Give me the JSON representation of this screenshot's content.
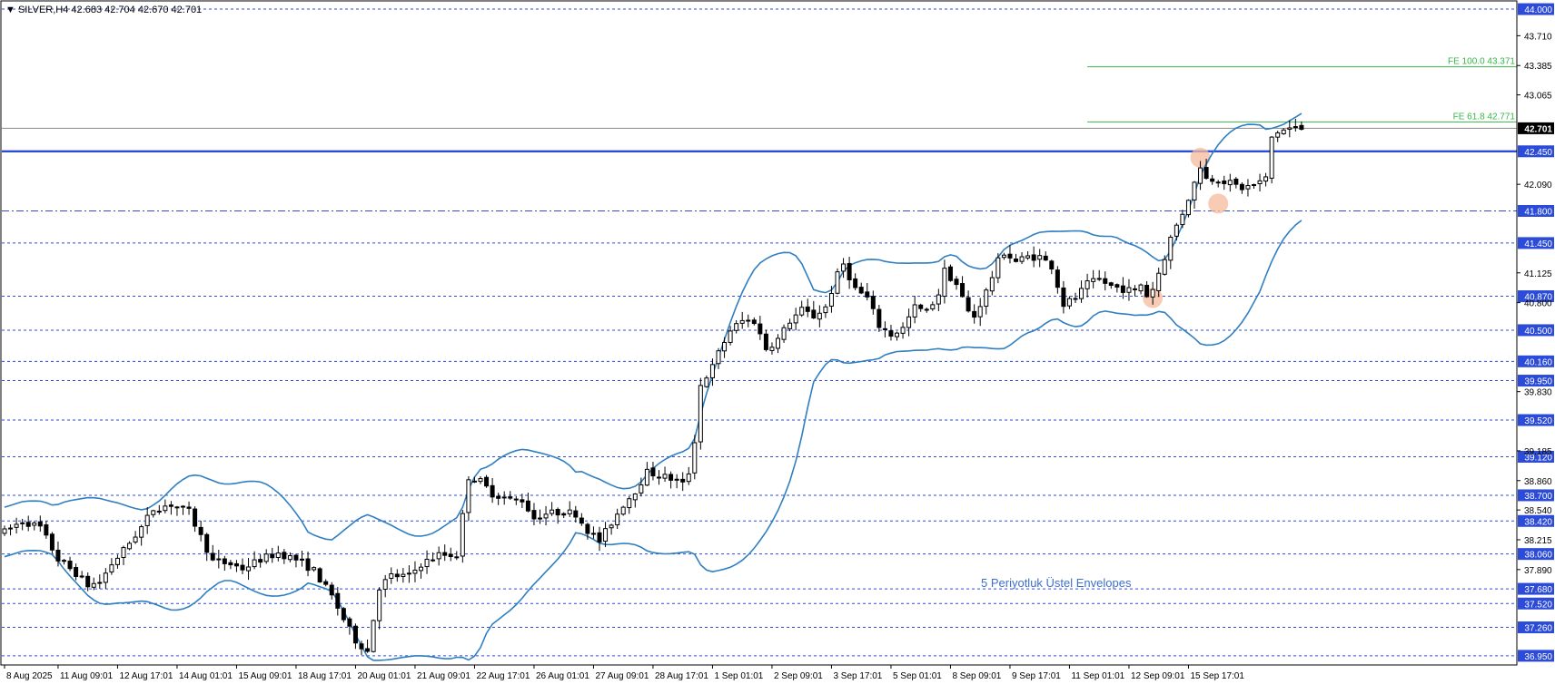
{
  "window": {
    "title_text": "▼ SILVER,H4  42.683 42.704 42.670 42.701"
  },
  "colors": {
    "background": "#ffffff",
    "frame": "#000000",
    "grid_dash": "#2b4bd8",
    "main_level": "#2b4bd8",
    "envelope": "#2f7fc1",
    "fib_line": "#39b54a",
    "fib_text": "#39b54a",
    "price_line": "#8a8a8a",
    "highlight": "#f6b99b",
    "tag_bg": "#2b4bd8",
    "tag_current_bg": "#000000",
    "annotation": "#3f70c8"
  },
  "annotation_text": "5 Periyotluk Üstel Envelopes",
  "chart_data": {
    "type": "candlestick",
    "symbol": "SILVER",
    "timeframe": "H4",
    "ylim": [
      36.85,
      44.05
    ],
    "y_ticks": [
      43.71,
      43.385,
      43.065,
      42.09,
      41.125,
      40.8,
      39.83,
      39.185,
      38.86,
      38.54,
      38.215,
      37.89
    ],
    "level_lines": [
      {
        "price": 44.0,
        "label": "44.000",
        "style": "dashed"
      },
      {
        "price": 42.45,
        "label": "42.450",
        "style": "solid"
      },
      {
        "price": 41.8,
        "label": "41.800",
        "style": "dashdot"
      },
      {
        "price": 41.45,
        "label": "41.450",
        "style": "dashed"
      },
      {
        "price": 40.87,
        "label": "40.870",
        "style": "dashed"
      },
      {
        "price": 40.5,
        "label": "40.500",
        "style": "dashed"
      },
      {
        "price": 40.16,
        "label": "40.160",
        "style": "dashed"
      },
      {
        "price": 39.95,
        "label": "39.950",
        "style": "dashed"
      },
      {
        "price": 39.52,
        "label": "39.520",
        "style": "dashed"
      },
      {
        "price": 39.12,
        "label": "39.120",
        "style": "dashed"
      },
      {
        "price": 38.7,
        "label": "38.700",
        "style": "dashed"
      },
      {
        "price": 38.42,
        "label": "38.420",
        "style": "dashed"
      },
      {
        "price": 38.06,
        "label": "38.060",
        "style": "dashed"
      },
      {
        "price": 37.68,
        "label": "37.680",
        "style": "dashed"
      },
      {
        "price": 37.52,
        "label": "37.520",
        "style": "dashed"
      },
      {
        "price": 37.26,
        "label": "37.260",
        "style": "dashed"
      },
      {
        "price": 36.95,
        "label": "36.950",
        "style": "dashed"
      }
    ],
    "current_price": {
      "price": 42.701,
      "label": "42.701"
    },
    "fibonacci": [
      {
        "label": "FE 100.0 43.371",
        "price": 43.371,
        "start_bar": 182
      },
      {
        "label": "FE 61.8 42.771",
        "price": 42.771,
        "start_bar": 182
      }
    ],
    "x_labels": [
      {
        "bar": 0,
        "label": "8 Aug 2025"
      },
      {
        "bar": 9,
        "label": "11 Aug 09:01"
      },
      {
        "bar": 19,
        "label": "12 Aug 17:01"
      },
      {
        "bar": 29,
        "label": "14 Aug 01:01"
      },
      {
        "bar": 39,
        "label": "15 Aug 09:01"
      },
      {
        "bar": 49,
        "label": "18 Aug 17:01"
      },
      {
        "bar": 59,
        "label": "20 Aug 01:01"
      },
      {
        "bar": 69,
        "label": "21 Aug 09:01"
      },
      {
        "bar": 79,
        "label": "22 Aug 17:01"
      },
      {
        "bar": 89,
        "label": "26 Aug 01:01"
      },
      {
        "bar": 99,
        "label": "27 Aug 09:01"
      },
      {
        "bar": 109,
        "label": "28 Aug 17:01"
      },
      {
        "bar": 119,
        "label": "1 Sep 01:01"
      },
      {
        "bar": 129,
        "label": "2 Sep 09:01"
      },
      {
        "bar": 139,
        "label": "3 Sep 17:01"
      },
      {
        "bar": 149,
        "label": "5 Sep 01:01"
      },
      {
        "bar": 159,
        "label": "8 Sep 09:01"
      },
      {
        "bar": 169,
        "label": "9 Sep 17:01"
      },
      {
        "bar": 179,
        "label": "11 Sep 01:01"
      },
      {
        "bar": 189,
        "label": "12 Sep 09:01"
      },
      {
        "bar": 199,
        "label": "15 Sep 17:01"
      }
    ],
    "anchors": [
      [
        0,
        38.3
      ],
      [
        3,
        38.42
      ],
      [
        6,
        38.35
      ],
      [
        9,
        38.0
      ],
      [
        12,
        37.85
      ],
      [
        14,
        37.72
      ],
      [
        16,
        37.75
      ],
      [
        18,
        37.95
      ],
      [
        20,
        38.1
      ],
      [
        23,
        38.35
      ],
      [
        25,
        38.55
      ],
      [
        28,
        38.6
      ],
      [
        31,
        38.52
      ],
      [
        33,
        38.25
      ],
      [
        35,
        37.98
      ],
      [
        38,
        37.95
      ],
      [
        40,
        37.9
      ],
      [
        43,
        38.0
      ],
      [
        46,
        38.07
      ],
      [
        49,
        38.0
      ],
      [
        52,
        37.88
      ],
      [
        55,
        37.6
      ],
      [
        57,
        37.35
      ],
      [
        59,
        37.12
      ],
      [
        61,
        37.0
      ],
      [
        63,
        37.7
      ],
      [
        65,
        37.82
      ],
      [
        68,
        37.82
      ],
      [
        70,
        37.95
      ],
      [
        73,
        38.05
      ],
      [
        76,
        38.05
      ],
      [
        78,
        38.9
      ],
      [
        80,
        38.85
      ],
      [
        82,
        38.72
      ],
      [
        85,
        38.65
      ],
      [
        87,
        38.65
      ],
      [
        89,
        38.45
      ],
      [
        91,
        38.5
      ],
      [
        94,
        38.52
      ],
      [
        96,
        38.5
      ],
      [
        98,
        38.32
      ],
      [
        100,
        38.2
      ],
      [
        102,
        38.4
      ],
      [
        104,
        38.6
      ],
      [
        106,
        38.75
      ],
      [
        108,
        38.95
      ],
      [
        110,
        38.92
      ],
      [
        112,
        38.88
      ],
      [
        114,
        38.82
      ],
      [
        115,
        38.95
      ],
      [
        116,
        39.3
      ],
      [
        117,
        39.9
      ],
      [
        119,
        40.1
      ],
      [
        120,
        40.25
      ],
      [
        122,
        40.5
      ],
      [
        124,
        40.6
      ],
      [
        126,
        40.6
      ],
      [
        128,
        40.3
      ],
      [
        130,
        40.4
      ],
      [
        132,
        40.6
      ],
      [
        134,
        40.72
      ],
      [
        136,
        40.65
      ],
      [
        138,
        40.75
      ],
      [
        140,
        41.1
      ],
      [
        141,
        41.22
      ],
      [
        143,
        40.95
      ],
      [
        145,
        40.85
      ],
      [
        147,
        40.55
      ],
      [
        149,
        40.45
      ],
      [
        151,
        40.52
      ],
      [
        153,
        40.75
      ],
      [
        155,
        40.7
      ],
      [
        157,
        40.9
      ],
      [
        158,
        41.15
      ],
      [
        160,
        41.0
      ],
      [
        162,
        40.7
      ],
      [
        163,
        40.65
      ],
      [
        165,
        40.92
      ],
      [
        167,
        41.25
      ],
      [
        168,
        41.35
      ],
      [
        170,
        41.25
      ],
      [
        172,
        41.3
      ],
      [
        174,
        41.3
      ],
      [
        176,
        41.2
      ],
      [
        178,
        40.78
      ],
      [
        180,
        40.85
      ],
      [
        182,
        41.0
      ],
      [
        184,
        41.05
      ],
      [
        186,
        40.98
      ],
      [
        188,
        40.95
      ],
      [
        190,
        40.92
      ],
      [
        191,
        41.0
      ],
      [
        192,
        40.88
      ],
      [
        193,
        40.95
      ],
      [
        195,
        41.3
      ],
      [
        196,
        41.5
      ],
      [
        198,
        41.78
      ],
      [
        200,
        42.1
      ],
      [
        201,
        42.3
      ],
      [
        202,
        42.15
      ],
      [
        204,
        42.15
      ],
      [
        206,
        42.1
      ],
      [
        208,
        42.05
      ],
      [
        210,
        42.08
      ],
      [
        212,
        42.15
      ],
      [
        213,
        42.6
      ],
      [
        214,
        42.66
      ],
      [
        216,
        42.7
      ],
      [
        218,
        42.7
      ]
    ]
  }
}
